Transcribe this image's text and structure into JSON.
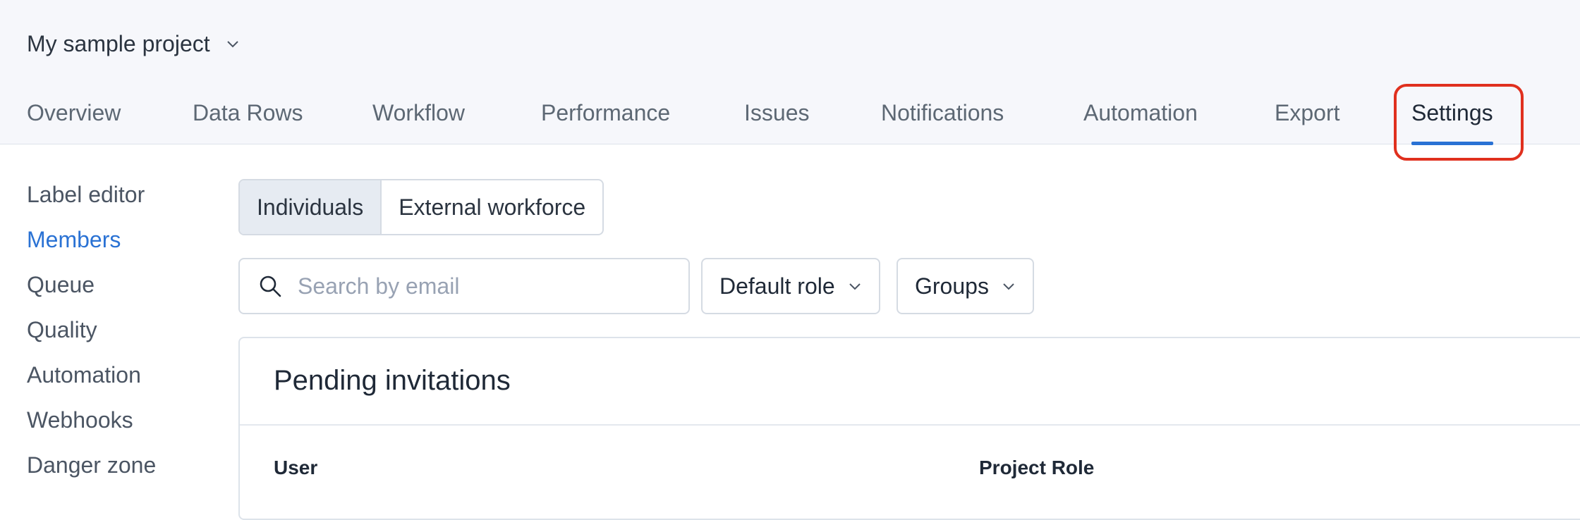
{
  "project": {
    "name": "My sample project",
    "icon": "chevron-down-icon"
  },
  "tabs": [
    {
      "label": "Overview",
      "active": false
    },
    {
      "label": "Data Rows",
      "active": false
    },
    {
      "label": "Workflow",
      "active": false
    },
    {
      "label": "Performance",
      "active": false
    },
    {
      "label": "Issues",
      "active": false
    },
    {
      "label": "Notifications",
      "active": false
    },
    {
      "label": "Automation",
      "active": false
    },
    {
      "label": "Export",
      "active": false
    },
    {
      "label": "Settings",
      "active": true
    }
  ],
  "sidebar": {
    "items": [
      {
        "label": "Label editor",
        "active": false
      },
      {
        "label": "Members",
        "active": true
      },
      {
        "label": "Queue",
        "active": false
      },
      {
        "label": "Quality",
        "active": false
      },
      {
        "label": "Automation",
        "active": false
      },
      {
        "label": "Webhooks",
        "active": false
      },
      {
        "label": "Danger zone",
        "active": false
      }
    ]
  },
  "members": {
    "segments": [
      {
        "label": "Individuals",
        "active": true
      },
      {
        "label": "External workforce",
        "active": false
      }
    ],
    "search": {
      "placeholder": "Search by email",
      "value": "",
      "icon": "search-icon"
    },
    "filters": {
      "default_role": "Default role",
      "groups": "Groups"
    },
    "pending": {
      "title": "Pending invitations",
      "columns": [
        "User",
        "Project Role"
      ]
    }
  },
  "colors": {
    "accent": "#2a72d4",
    "highlight": "#e0301e",
    "header_bg": "#f6f7fb"
  }
}
